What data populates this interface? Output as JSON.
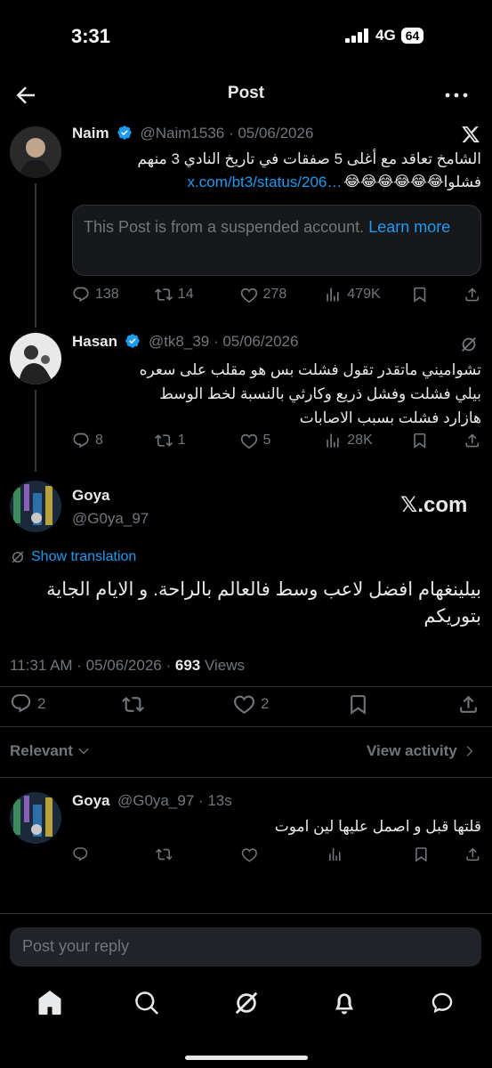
{
  "status_bar": {
    "time": "3:31",
    "network": "4G",
    "battery": "64"
  },
  "header": {
    "title": "Post"
  },
  "tweet1": {
    "name": "Naim",
    "handle": "@Naim1536 · 05/06/2026",
    "text_line1": "الشامخ تعاقد مع أغلى 5 صفقات في تاريخ النادي 3 منهم",
    "text_line2_words": "فشلوا",
    "text_line2_emoji": "😂😂😂😂😂😂",
    "link": "x.com/bt3/status/206…",
    "card_text": "This Post is from a suspended account.",
    "card_link": "Learn more",
    "replies": "138",
    "reposts": "14",
    "likes": "278",
    "views": "479K"
  },
  "tweet2": {
    "name": "Hasan",
    "handle": "@tk8_39 · 05/06/2026",
    "line1": "تشواميني ماتقدر تقول فشلت بس هو مقلب على سعره",
    "line2": "بيلي فشلت وفشل ذريع وكارثي  بالنسبة لخط الوسط",
    "line3": "هازارد فشلت بسبب الاصابات",
    "replies": "8",
    "reposts": "1",
    "likes": "5",
    "views": "28K"
  },
  "main_tweet": {
    "name": "Goya",
    "handle": "@G0ya_97",
    "watermark": "𝕏.com",
    "show_translation": "Show translation",
    "line1": "بيلينغهام افضل لاعب وسط فالعالم بالراحة. و الايام الجاية",
    "line2": "بتوريكم",
    "timestamp": "11:31 AM · 05/06/2026 ·",
    "views_count": "693",
    "views_label": "Views",
    "replies": "2",
    "likes": "2"
  },
  "sort_bar": {
    "relevant": "Relevant",
    "view_activity": "View activity"
  },
  "reply1": {
    "name": "Goya",
    "handle": "@G0ya_97 · 13s",
    "text": "قلتها قبل و اصمل عليها لين اموت"
  },
  "composer": {
    "placeholder": "Post your reply"
  },
  "colors": {
    "accent": "#1d9bf0",
    "background": "#000000",
    "muted": "#71767b",
    "text": "#e7e9ea"
  }
}
